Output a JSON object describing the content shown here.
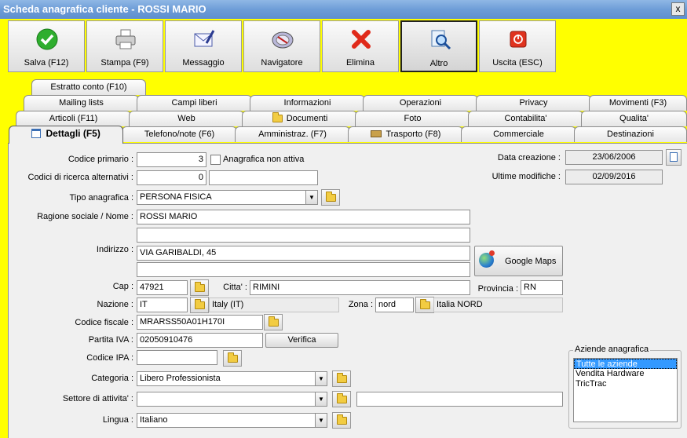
{
  "window": {
    "title": "Scheda anagrafica cliente - ROSSI MARIO",
    "close": "x"
  },
  "toolbar": {
    "save": "Salva (F12)",
    "print": "Stampa (F9)",
    "message": "Messaggio",
    "navigator": "Navigatore",
    "delete": "Elimina",
    "other": "Altro",
    "exit": "Uscita (ESC)"
  },
  "tabs": {
    "row1": [
      "Estratto conto (F10)"
    ],
    "row2": [
      "Mailing lists",
      "Campi liberi",
      "Informazioni",
      "Operazioni",
      "Privacy",
      "Movimenti (F3)"
    ],
    "row3": [
      "Articoli (F11)",
      "Web",
      "Documenti",
      "Foto",
      "Contabilita'",
      "Qualita'"
    ],
    "row4": [
      "Dettagli (F5)",
      "Telefono/note (F6)",
      "Amministraz. (F7)",
      "Trasporto (F8)",
      "Commerciale",
      "Destinazioni"
    ]
  },
  "form": {
    "codice_primario_label": "Codice primario :",
    "codice_primario": "3",
    "non_attiva_label": "Anagrafica non attiva",
    "codici_ricerca_label": "Codici di ricerca alternativi :",
    "codici_ricerca": "0",
    "codici_ricerca_2": "",
    "data_creazione_label": "Data creazione :",
    "data_creazione": "23/06/2006",
    "ultime_modifiche_label": "Ultime modifiche :",
    "ultime_modifiche": "02/09/2016",
    "tipo_label": "Tipo anagrafica :",
    "tipo": "PERSONA FISICA",
    "ragione_label": "Ragione sociale / Nome :",
    "ragione": "ROSSI MARIO",
    "ragione_2": "",
    "indirizzo_label": "Indirizzo :",
    "indirizzo": "VIA GARIBALDI, 45",
    "indirizzo_2": "",
    "google_maps": "Google Maps",
    "cap_label": "Cap :",
    "cap": "47921",
    "citta_label": "Citta' :",
    "citta": "RIMINI",
    "provincia_label": "Provincia :",
    "provincia": "RN",
    "nazione_label": "Nazione :",
    "nazione": "IT",
    "nazione_desc": "Italy (IT)",
    "zona_label": "Zona :",
    "zona": "nord",
    "zona_desc": "Italia NORD",
    "cf_label": "Codice fiscale :",
    "cf": "MRARSS50A01H170I",
    "piva_label": "Partita IVA :",
    "piva": "02050910476",
    "verifica": "Verifica",
    "ipa_label": "Codice IPA :",
    "ipa": "",
    "categoria_label": "Categoria :",
    "categoria": "Libero Professionista",
    "settore_label": "Settore di attivita' :",
    "settore": "",
    "settore_note": "",
    "lingua_label": "Lingua :",
    "lingua": "Italiano"
  },
  "aziende": {
    "title": "Aziende anagrafica",
    "items": [
      "Tutte le aziende",
      "Vendita Hardware",
      "TricTrac"
    ]
  }
}
